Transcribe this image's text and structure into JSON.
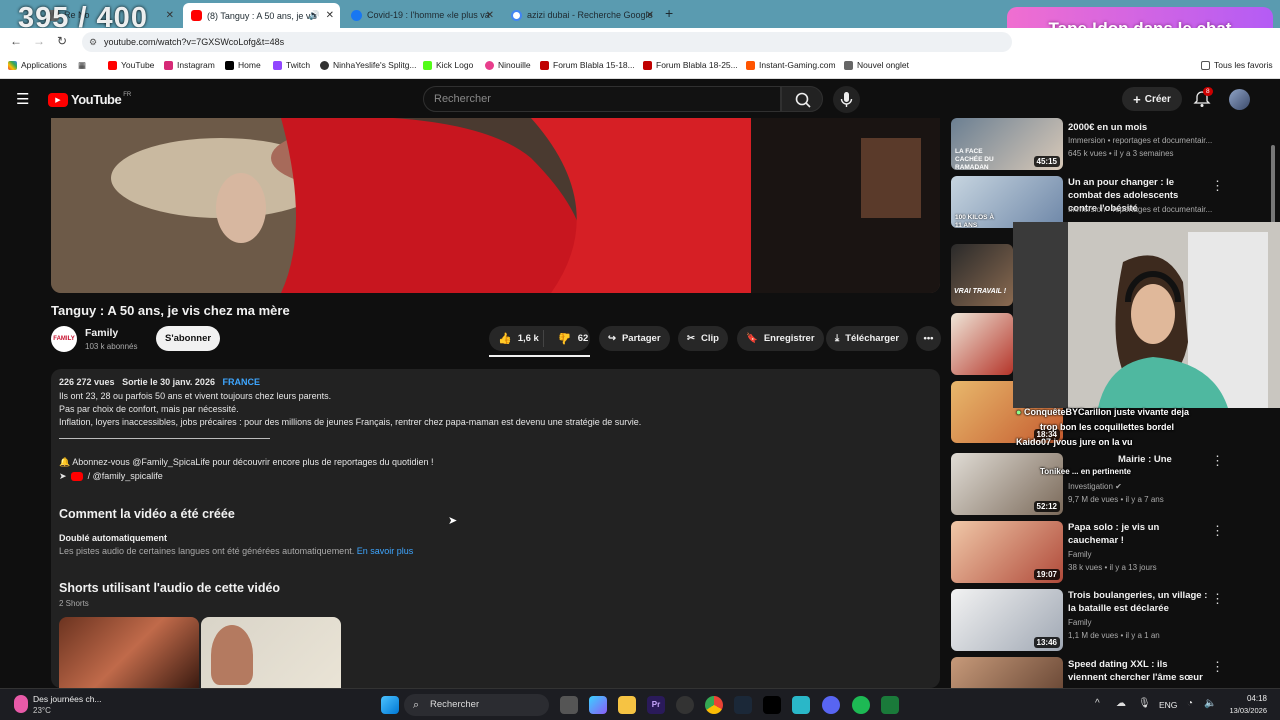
{
  "overlay": {
    "counter": "395 / 400",
    "don_banner": "Tape !don dans le chat"
  },
  "tabs": [
    {
      "title": "Re  No",
      "active": false
    },
    {
      "title": "(8) Tanguy : A 50 ans, je vis",
      "active": true
    },
    {
      "title": "Covid-19 : l'homme «le plus va",
      "active": false
    },
    {
      "title": "azizi dubai - Recherche Google",
      "active": false
    }
  ],
  "address": {
    "url": "youtube.com/watch?v=7GXSWcoLofg&t=48s"
  },
  "bookmarks": [
    {
      "label": "Applications",
      "color": "#ea4335"
    },
    {
      "label": "YouTube",
      "color": "#ff0000"
    },
    {
      "label": "Instagram",
      "color": "#d62976"
    },
    {
      "label": "Home",
      "color": "#000000"
    },
    {
      "label": "Twitch",
      "color": "#9146ff"
    },
    {
      "label": "NinhaYeslife's Splitg...",
      "color": "#333333"
    },
    {
      "label": "Kick Logo",
      "color": "#53fc18"
    },
    {
      "label": "Ninouille",
      "color": "#e83e8c"
    },
    {
      "label": "Forum Blabla 15-18...",
      "color": "#c00000"
    },
    {
      "label": "Forum Blabla 18-25...",
      "color": "#c00000"
    },
    {
      "label": "Instant-Gaming.com",
      "color": "#ff5400"
    },
    {
      "label": "Nouvel onglet",
      "color": "#666666"
    }
  ],
  "bookmarks_right": "Tous les favoris",
  "youtube": {
    "logo": "YouTube",
    "region": "FR",
    "search_placeholder": "Rechercher",
    "create": "Créer",
    "notif_count": "8"
  },
  "video": {
    "title": "Tanguy : A 50 ans, je vis chez ma mère",
    "channel": "Family",
    "channel_logo_text": "FAMILY",
    "subscribers": "103 k abonnés",
    "subscribe": "S'abonner",
    "likes": "1,6 k",
    "dislikes": "62",
    "share": "Partager",
    "clip": "Clip",
    "save": "Enregistrer",
    "download": "Télécharger"
  },
  "description": {
    "views": "226 272 vues",
    "date": "Sortie le 30 janv. 2026",
    "country": "FRANCE",
    "line1": "Ils ont 23, 28 ou parfois 50 ans et vivent toujours chez leurs parents.",
    "line2": "Pas par choix de confort, mais par nécessité.",
    "line3": "Inflation, loyers inaccessibles, jobs précaires : pour des millions de jeunes Français, rentrer chez papa-maman est devenu une stratégie de survie.",
    "line4": "🔔 Abonnez-vous @Family_SpicaLife pour découvrir encore plus de reportages du quotidien !",
    "line5": "/ @family_spicalife",
    "how_title": "Comment la vidéo a été créée",
    "dubbed_title": "Doublé automatiquement",
    "dubbed_text": "Les pistes audio de certaines langues ont été générées automatiquement.",
    "learn_more": "En savoir plus",
    "shorts_title": "Shorts utilisant l'audio de cette vidéo",
    "shorts_count": "2 Shorts"
  },
  "recommendations": [
    {
      "title": "2000€ en un mois",
      "channel": "Immersion • reportages et documentair...",
      "meta": "645 k vues • il y a 3 semaines",
      "duration": "45:15",
      "thumb_text": "LA FACE CACHÉE DU RAMADAN"
    },
    {
      "title": "Un an pour changer : le combat des adolescents contre l'obésité",
      "channel": "Immersion • reportages et documentair...",
      "meta": "",
      "duration": "",
      "thumb_text": "100 KILOS À 11 ANS"
    },
    {
      "title": "",
      "channel": "",
      "meta": "",
      "duration": "",
      "thumb_text": "VRAI TRAVAIL !"
    },
    {
      "title": "",
      "channel": "",
      "meta": "",
      "duration": "",
      "thumb_text": ""
    },
    {
      "title": "",
      "channel": "",
      "meta": "",
      "duration": "18:34",
      "thumb_text": ""
    },
    {
      "title": "Mairie : Une",
      "channel": "Investigation",
      "meta": "9,7 M de vues • il y a 7 ans",
      "duration": "52:12",
      "thumb_text": ""
    },
    {
      "title": "Papa solo : je vis un cauchemar !",
      "channel": "Family",
      "meta": "38 k vues • il y a 13 jours",
      "duration": "19:07",
      "thumb_text": ""
    },
    {
      "title": "Trois boulangeries, un village : la bataille est déclarée",
      "channel": "Family",
      "meta": "1,1 M de vues • il y a 1 an",
      "duration": "13:46",
      "thumb_text": ""
    },
    {
      "title": "Speed dating XXL : ils viennent chercher l'âme sœur",
      "channel": "",
      "meta": "",
      "duration": "",
      "thumb_text": ""
    }
  ],
  "chat": [
    "ConquêteBYCarillon juste vivante deja",
    "trop bon les coquillettes bordel",
    "Kaido07 jvous jure on la vu",
    "Tonikee  ... en pertinente"
  ],
  "taskbar": {
    "weather_title": "Des journées ch...",
    "weather_temp": "23°C",
    "search": "Rechercher",
    "lang": "ENG",
    "time": "04:18",
    "date": "13/03/2026"
  }
}
